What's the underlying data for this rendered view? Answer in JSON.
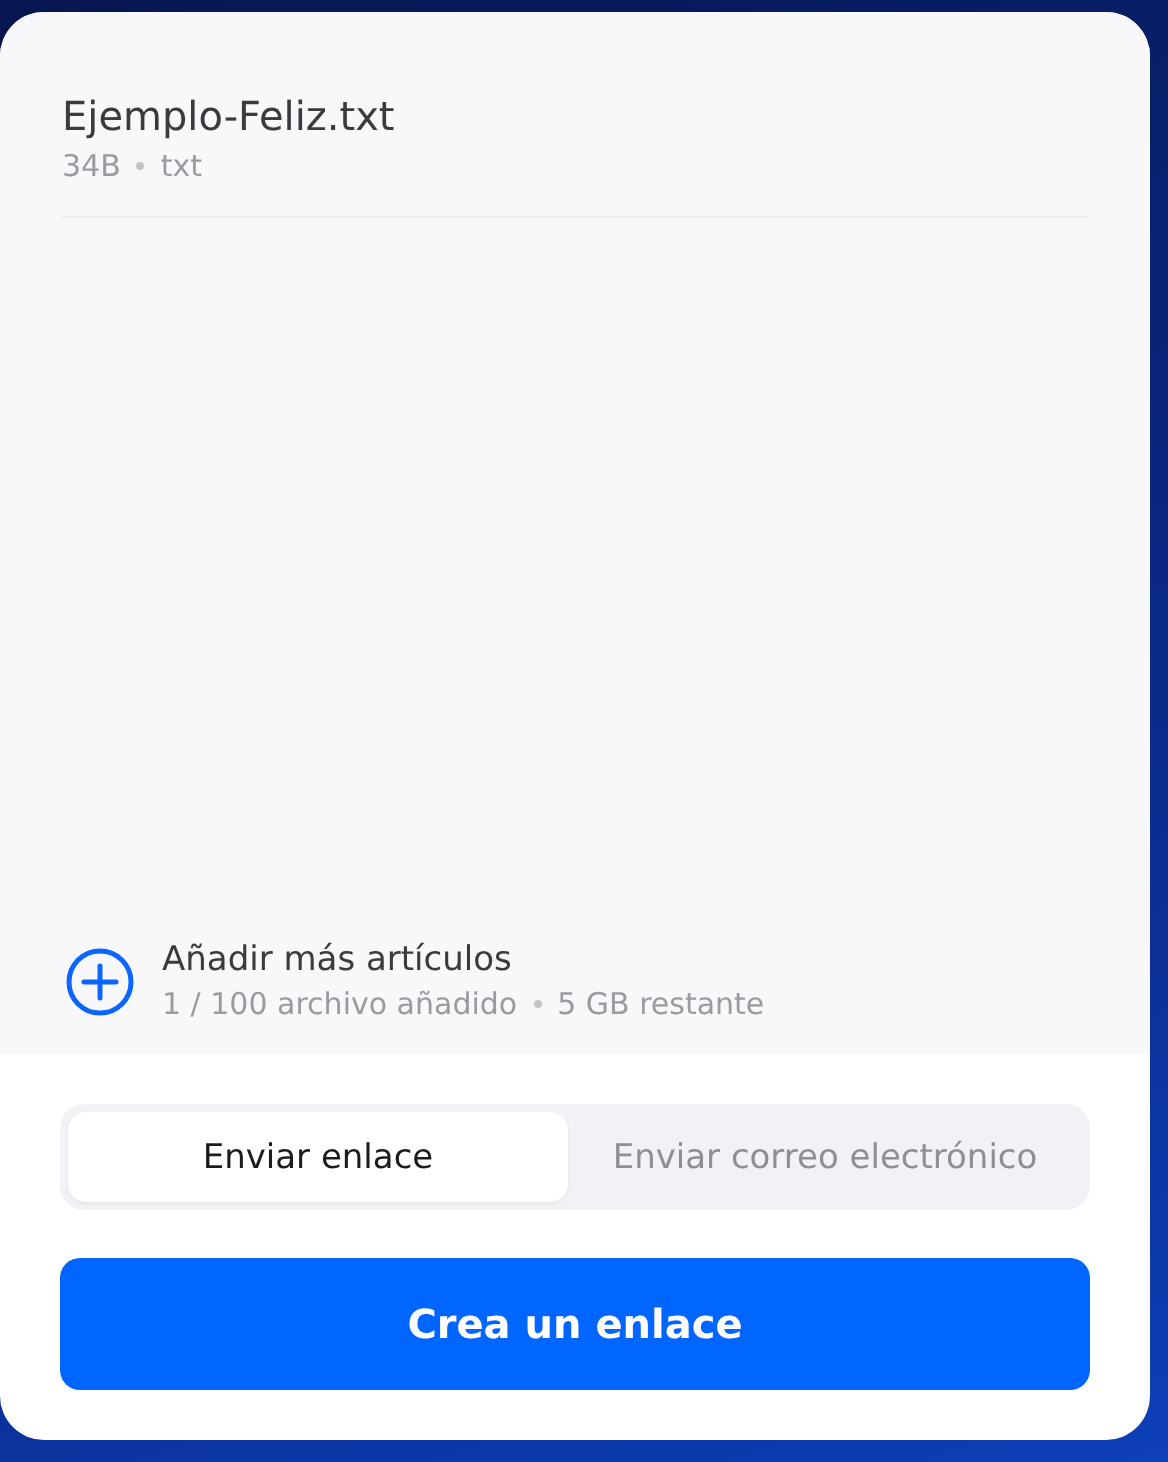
{
  "file": {
    "name": "Ejemplo-Feliz.txt",
    "meta": [
      "34B",
      "txt"
    ]
  },
  "add_items": {
    "label": "Añadir más artículos",
    "meta": [
      "1 / 100 archivo añadido",
      "5 GB restante"
    ]
  },
  "tabs": [
    {
      "label": "Enviar enlace",
      "selected": true
    },
    {
      "label": "Enviar correo electrónico",
      "selected": false
    }
  ],
  "primary_button": {
    "label": "Crea un enlace"
  }
}
